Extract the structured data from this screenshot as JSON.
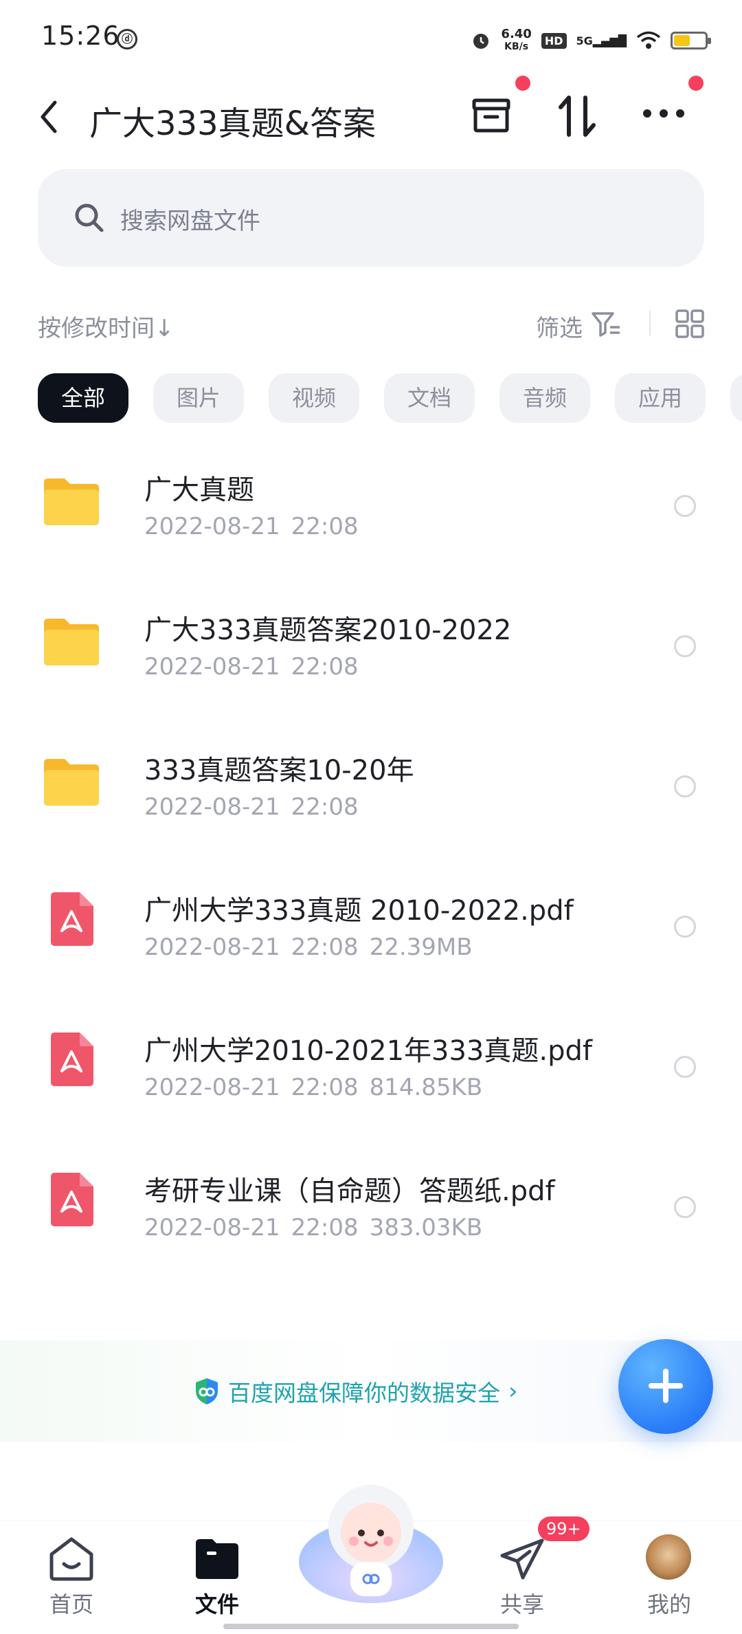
{
  "status_bar": {
    "time": "15:26",
    "net_speed": "6.40",
    "net_unit": "KB/s",
    "hd": "HD",
    "signal": "5G"
  },
  "header": {
    "title": "广大333真题&答案"
  },
  "search": {
    "placeholder": "搜索网盘文件"
  },
  "sort": {
    "label": "按修改时间↓",
    "filter_label": "筛选"
  },
  "chips": [
    "全部",
    "图片",
    "视频",
    "文档",
    "音频",
    "应用"
  ],
  "files": [
    {
      "type": "folder",
      "name": "广大真题",
      "date": "2022-08-21",
      "time": "22:08",
      "size": ""
    },
    {
      "type": "folder",
      "name": "广大333真题答案2010-2022",
      "date": "2022-08-21",
      "time": "22:08",
      "size": ""
    },
    {
      "type": "folder",
      "name": "333真题答案10-20年",
      "date": "2022-08-21",
      "time": "22:08",
      "size": ""
    },
    {
      "type": "pdf",
      "name": "广州大学333真题 2010-2022.pdf",
      "date": "2022-08-21",
      "time": "22:08",
      "size": "22.39MB"
    },
    {
      "type": "pdf",
      "name": "广州大学2010-2021年333真题.pdf",
      "date": "2022-08-21",
      "time": "22:08",
      "size": "814.85KB"
    },
    {
      "type": "pdf",
      "name": "考研专业课（自命题）答题纸.pdf",
      "date": "2022-08-21",
      "time": "22:08",
      "size": "383.03KB"
    }
  ],
  "safety": {
    "text": "百度网盘保障你的数据安全"
  },
  "bottom_nav": {
    "home": "首页",
    "files": "文件",
    "share": "共享",
    "mine": "我的",
    "share_badge": "99+"
  },
  "colors": {
    "accent": "#2a7cf7",
    "red_dot": "#f53f5c",
    "folder": "#fcc93a",
    "pdf": "#f0566a",
    "safety": "#1fa3ad"
  }
}
